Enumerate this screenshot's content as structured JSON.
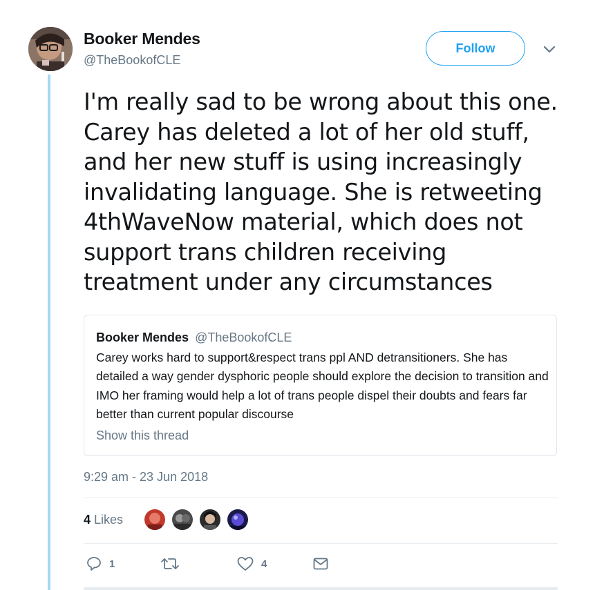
{
  "tweet": {
    "author_name": "Booker Mendes",
    "author_handle": "@TheBookofCLE",
    "follow_label": "Follow",
    "text": "I'm really sad to be wrong about this one. Carey has deleted a lot of her old stuff, and her new stuff is using increasingly invalidating language. She is retweeting 4thWaveNow material, which does not support trans children receiving treatment under any circumstances",
    "timestamp": "9:29 am - 23 Jun 2018"
  },
  "quoted_tweet": {
    "author_name": "Booker Mendes",
    "author_handle": "@TheBookofCLE",
    "text": "Carey works hard to support&respect trans ppl AND detransitioners. She has detailed a way gender dysphoric people should explore the decision to transition and IMO her framing would help a lot of trans people dispel their doubts and fears far better than current popular discourse",
    "show_thread_label": "Show this thread"
  },
  "likes": {
    "count": "4",
    "label": "Likes"
  },
  "actions": {
    "reply_icon": "reply-icon",
    "reply_count": "1",
    "retweet_icon": "retweet-icon",
    "like_icon": "heart-icon",
    "like_count": "4",
    "message_icon": "envelope-icon"
  },
  "colors": {
    "accent": "#1da1f2",
    "thread_line": "#a7d8f5",
    "secondary_text": "#657786",
    "border": "#e1e8ed"
  }
}
